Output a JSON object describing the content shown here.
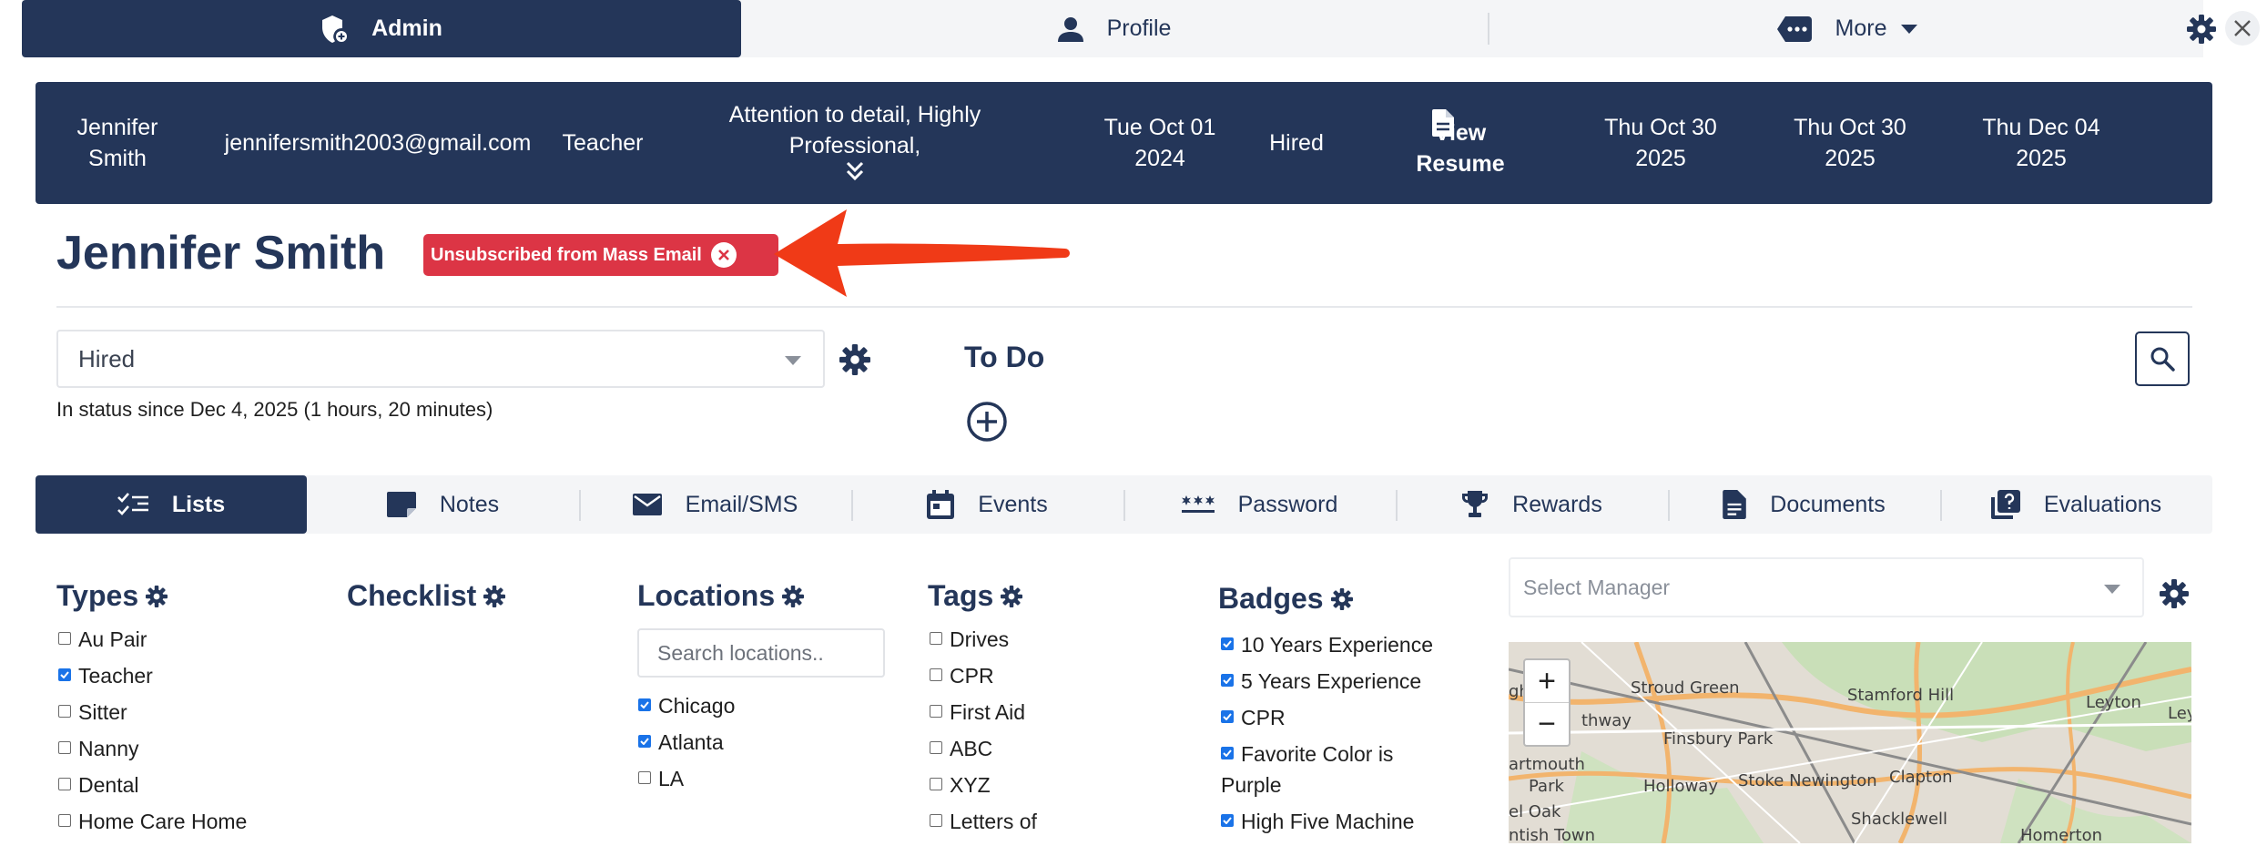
{
  "top_tabs": [
    {
      "label": "Admin",
      "icon": "admin-shield-icon",
      "active": true
    },
    {
      "label": "Profile",
      "icon": "user-icon"
    },
    {
      "label": "More",
      "icon": "more-dots-icon"
    }
  ],
  "banner": {
    "name": "Jennifer Smith",
    "email": "jennifersmith2003@gmail.com",
    "role": "Teacher",
    "traits": "Attention to detail, Highly Professional,",
    "start_date": "Tue Oct 01 2024",
    "status": "Hired",
    "resume_label": "View Resume",
    "date_1": "Thu Oct 30 2025",
    "date_2": "Thu Oct 30 2025",
    "date_3": "Thu Dec 04 2025"
  },
  "candidate": {
    "name": "Jennifer Smith",
    "badge": "Unsubscribed from Mass Email"
  },
  "status": {
    "value": "Hired",
    "since": "In status since Dec 4, 2025 (1 hours, 20 minutes)"
  },
  "todo": {
    "title": "To Do"
  },
  "sub_tabs": [
    {
      "label": "Lists",
      "icon": "checklist-icon",
      "active": true
    },
    {
      "label": "Notes",
      "icon": "note-icon"
    },
    {
      "label": "Email/SMS",
      "icon": "mail-icon"
    },
    {
      "label": "Events",
      "icon": "calendar-icon"
    },
    {
      "label": "Password",
      "icon": "password-icon"
    },
    {
      "label": "Rewards",
      "icon": "trophy-icon"
    },
    {
      "label": "Documents",
      "icon": "document-icon"
    },
    {
      "label": "Evaluations",
      "icon": "evaluations-icon"
    }
  ],
  "types": {
    "title": "Types",
    "items": [
      {
        "label": "Au Pair",
        "checked": false
      },
      {
        "label": "Teacher",
        "checked": true
      },
      {
        "label": "Sitter",
        "checked": false
      },
      {
        "label": "Nanny",
        "checked": false
      },
      {
        "label": "Dental",
        "checked": false
      },
      {
        "label": "Home Care Home",
        "checked": false
      }
    ]
  },
  "checklist": {
    "title": "Checklist"
  },
  "locations": {
    "title": "Locations",
    "search_placeholder": "Search locations..",
    "items": [
      {
        "label": "Chicago",
        "checked": true
      },
      {
        "label": "Atlanta",
        "checked": true
      },
      {
        "label": "LA",
        "checked": false
      }
    ]
  },
  "tags": {
    "title": "Tags",
    "items": [
      {
        "label": "Drives",
        "checked": false
      },
      {
        "label": "CPR",
        "checked": false
      },
      {
        "label": "First Aid",
        "checked": false
      },
      {
        "label": "ABC",
        "checked": false
      },
      {
        "label": "XYZ",
        "checked": false
      },
      {
        "label": "Letters of",
        "checked": false
      }
    ]
  },
  "badges": {
    "title": "Badges",
    "items": [
      {
        "label": "10 Years Experience",
        "checked": true
      },
      {
        "label": "5 Years Experience",
        "checked": true
      },
      {
        "label": "CPR",
        "checked": true
      },
      {
        "label": "Favorite Color is",
        "label2": "Purple",
        "checked": true
      },
      {
        "label": "High Five Machine",
        "checked": true
      }
    ]
  },
  "manager": {
    "placeholder": "Select Manager"
  },
  "map": {
    "zoom_in": "+",
    "zoom_out": "−",
    "labels": [
      "Stroud Green",
      "Stamford Hill",
      "Leyton",
      "Finsbury Park",
      "Holloway",
      "Stoke Newington",
      "Clapton",
      "Park",
      "Shacklewell",
      "Homerton",
      "ntish Town",
      "el Oak",
      "artmouth",
      "thway",
      "gh",
      "Leyto"
    ]
  },
  "colors": {
    "navy": "#243659",
    "danger": "#dc3545",
    "checkbox": "#1a73e8",
    "arrow": "#f03a17"
  }
}
